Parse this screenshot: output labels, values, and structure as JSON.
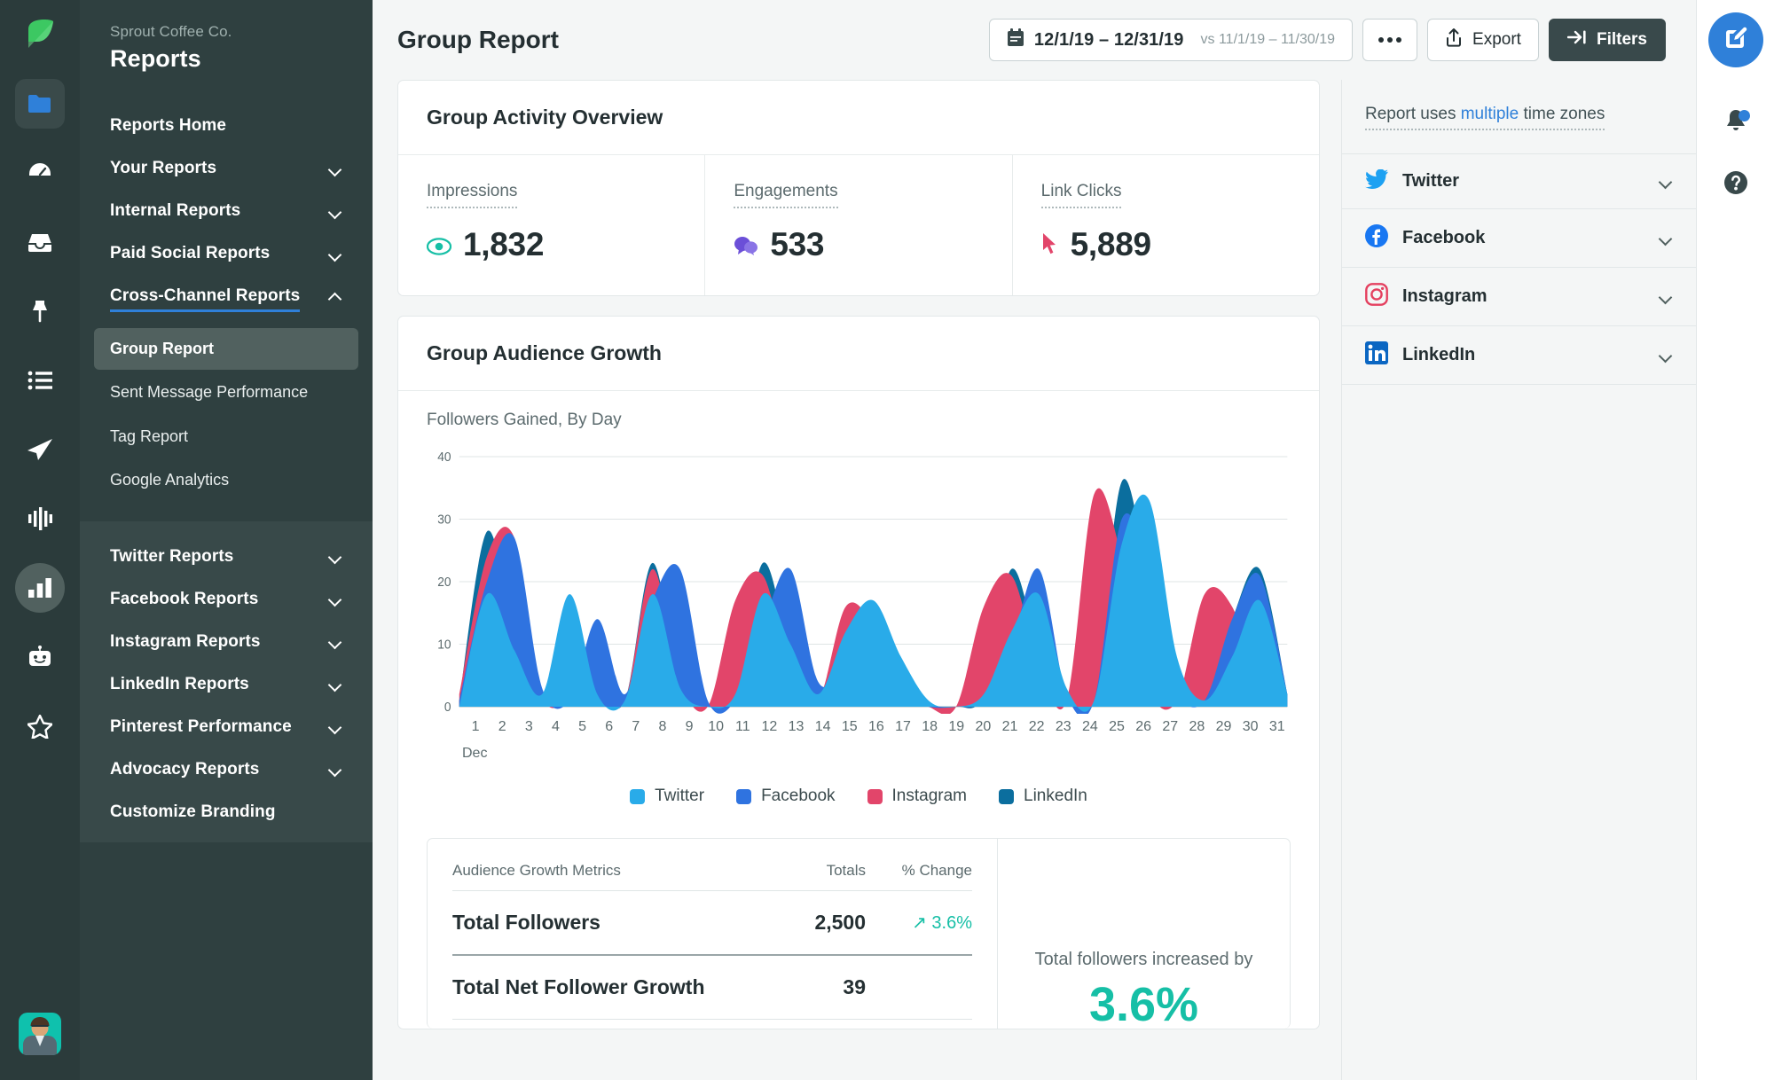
{
  "rail": {
    "logo": "sprout-leaf-logo",
    "icons": [
      {
        "name": "folder-icon",
        "active": true
      },
      {
        "name": "dashboard-gauge-icon",
        "active": false
      },
      {
        "name": "inbox-icon",
        "active": false
      },
      {
        "name": "pin-icon",
        "active": false
      },
      {
        "name": "list-icon",
        "active": false
      },
      {
        "name": "publishing-paper-plane-icon",
        "active": false
      },
      {
        "name": "listening-waveform-icon",
        "active": false
      },
      {
        "name": "reports-bar-chart-icon",
        "active": true
      },
      {
        "name": "bot-icon",
        "active": false
      },
      {
        "name": "star-icon",
        "active": false
      }
    ],
    "avatar_label": "user-avatar"
  },
  "sidebar": {
    "org": "Sprout Coffee Co.",
    "title": "Reports",
    "top_items": [
      {
        "label": "Reports Home",
        "expandable": false,
        "open": false
      },
      {
        "label": "Your Reports",
        "expandable": true,
        "open": false
      },
      {
        "label": "Internal Reports",
        "expandable": true,
        "open": false
      },
      {
        "label": "Paid Social Reports",
        "expandable": true,
        "open": false
      },
      {
        "label": "Cross-Channel Reports",
        "expandable": true,
        "open": true
      }
    ],
    "sub_items": [
      {
        "label": "Group Report",
        "active": true
      },
      {
        "label": "Sent Message Performance",
        "active": false
      },
      {
        "label": "Tag Report",
        "active": false
      },
      {
        "label": "Google Analytics",
        "active": false
      }
    ],
    "bottom_items": [
      {
        "label": "Twitter Reports",
        "expandable": true
      },
      {
        "label": "Facebook Reports",
        "expandable": true
      },
      {
        "label": "Instagram Reports",
        "expandable": true
      },
      {
        "label": "LinkedIn Reports",
        "expandable": true
      },
      {
        "label": "Pinterest Performance",
        "expandable": true
      },
      {
        "label": "Advocacy Reports",
        "expandable": true
      },
      {
        "label": "Customize Branding",
        "expandable": false
      }
    ]
  },
  "topbar": {
    "title": "Group Report",
    "date_range": "12/1/19 – 12/31/19",
    "date_compare": "vs 11/1/19 – 11/30/19",
    "more_label": "•••",
    "export_label": "Export",
    "filters_label": "Filters"
  },
  "overview": {
    "title": "Group Activity Overview",
    "metrics": [
      {
        "label": "Impressions",
        "value": "1,832",
        "icon": "impressions-eye-icon",
        "color": "#16bfa6"
      },
      {
        "label": "Engagements",
        "value": "533",
        "icon": "engagements-bubble-icon",
        "color": "#6b4fd8"
      },
      {
        "label": "Link Clicks",
        "value": "5,889",
        "icon": "link-clicks-cursor-icon",
        "color": "#e2456a"
      }
    ]
  },
  "growth": {
    "title": "Group Audience Growth",
    "summary_note": "Total followers increased by",
    "summary_pct": "3.6%",
    "table": {
      "col_metric": "Audience Growth Metrics",
      "col_totals": "Totals",
      "col_change": "% Change",
      "rows": [
        {
          "metric": "Total Followers",
          "total": "2,500",
          "change": "3.6%",
          "change_dir": "up"
        },
        {
          "metric": "Total Net Follower Growth",
          "total": "39",
          "change": "",
          "change_dir": ""
        }
      ]
    }
  },
  "chart_data": {
    "type": "area",
    "title": "Followers Gained, By Day",
    "xlabel": "Dec",
    "ylabel": "",
    "ylim": [
      0,
      40
    ],
    "yticks": [
      0,
      10,
      20,
      30,
      40
    ],
    "grid": true,
    "legend_position": "bottom",
    "x": [
      1,
      2,
      3,
      4,
      5,
      6,
      7,
      8,
      9,
      10,
      11,
      12,
      13,
      14,
      15,
      16,
      17,
      18,
      19,
      20,
      21,
      22,
      23,
      24,
      25,
      26,
      27,
      28,
      29,
      30,
      31
    ],
    "series": [
      {
        "name": "Twitter",
        "color": "#29abe9",
        "values": [
          0,
          18,
          9,
          2,
          18,
          2,
          1,
          18,
          3,
          0,
          2,
          18,
          10,
          2,
          12,
          17,
          8,
          1,
          0,
          2,
          12,
          18,
          3,
          1,
          26,
          33,
          8,
          1,
          8,
          17,
          2
        ]
      },
      {
        "name": "Facebook",
        "color": "#2f73e0",
        "values": [
          1,
          20,
          27,
          3,
          1,
          14,
          2,
          17,
          22,
          1,
          1,
          13,
          22,
          4,
          6,
          7,
          2,
          0,
          0,
          1,
          10,
          22,
          2,
          1,
          30,
          22,
          3,
          1,
          14,
          21,
          2
        ]
      },
      {
        "name": "Instagram",
        "color": "#e2456a",
        "values": [
          2,
          24,
          27,
          2,
          1,
          2,
          1,
          22,
          4,
          0,
          17,
          21,
          6,
          1,
          16,
          13,
          3,
          0,
          0,
          16,
          21,
          7,
          1,
          34,
          24,
          3,
          1,
          18,
          16,
          3,
          1
        ]
      },
      {
        "name": "LinkedIn",
        "color": "#0b6e9e",
        "values": [
          1,
          28,
          12,
          2,
          1,
          2,
          1,
          23,
          3,
          0,
          2,
          23,
          9,
          1,
          7,
          10,
          3,
          0,
          0,
          2,
          22,
          9,
          1,
          2,
          36,
          20,
          3,
          1,
          14,
          22,
          2
        ]
      }
    ]
  },
  "right_panel": {
    "timezone_prefix": "Report uses ",
    "timezone_link": "multiple",
    "timezone_suffix": " time zones",
    "networks": [
      {
        "name": "Twitter",
        "icon": "twitter-bird-icon",
        "color": "#1da1f2"
      },
      {
        "name": "Facebook",
        "icon": "facebook-f-icon",
        "color": "#1877f2"
      },
      {
        "name": "Instagram",
        "icon": "instagram-camera-icon",
        "color": "#e4405f"
      },
      {
        "name": "LinkedIn",
        "icon": "linkedin-in-icon",
        "color": "#0a66c2"
      }
    ]
  },
  "utility_rail": {
    "compose": "compose-button",
    "notifications": "notifications-bell-icon",
    "help": "help-question-icon"
  }
}
